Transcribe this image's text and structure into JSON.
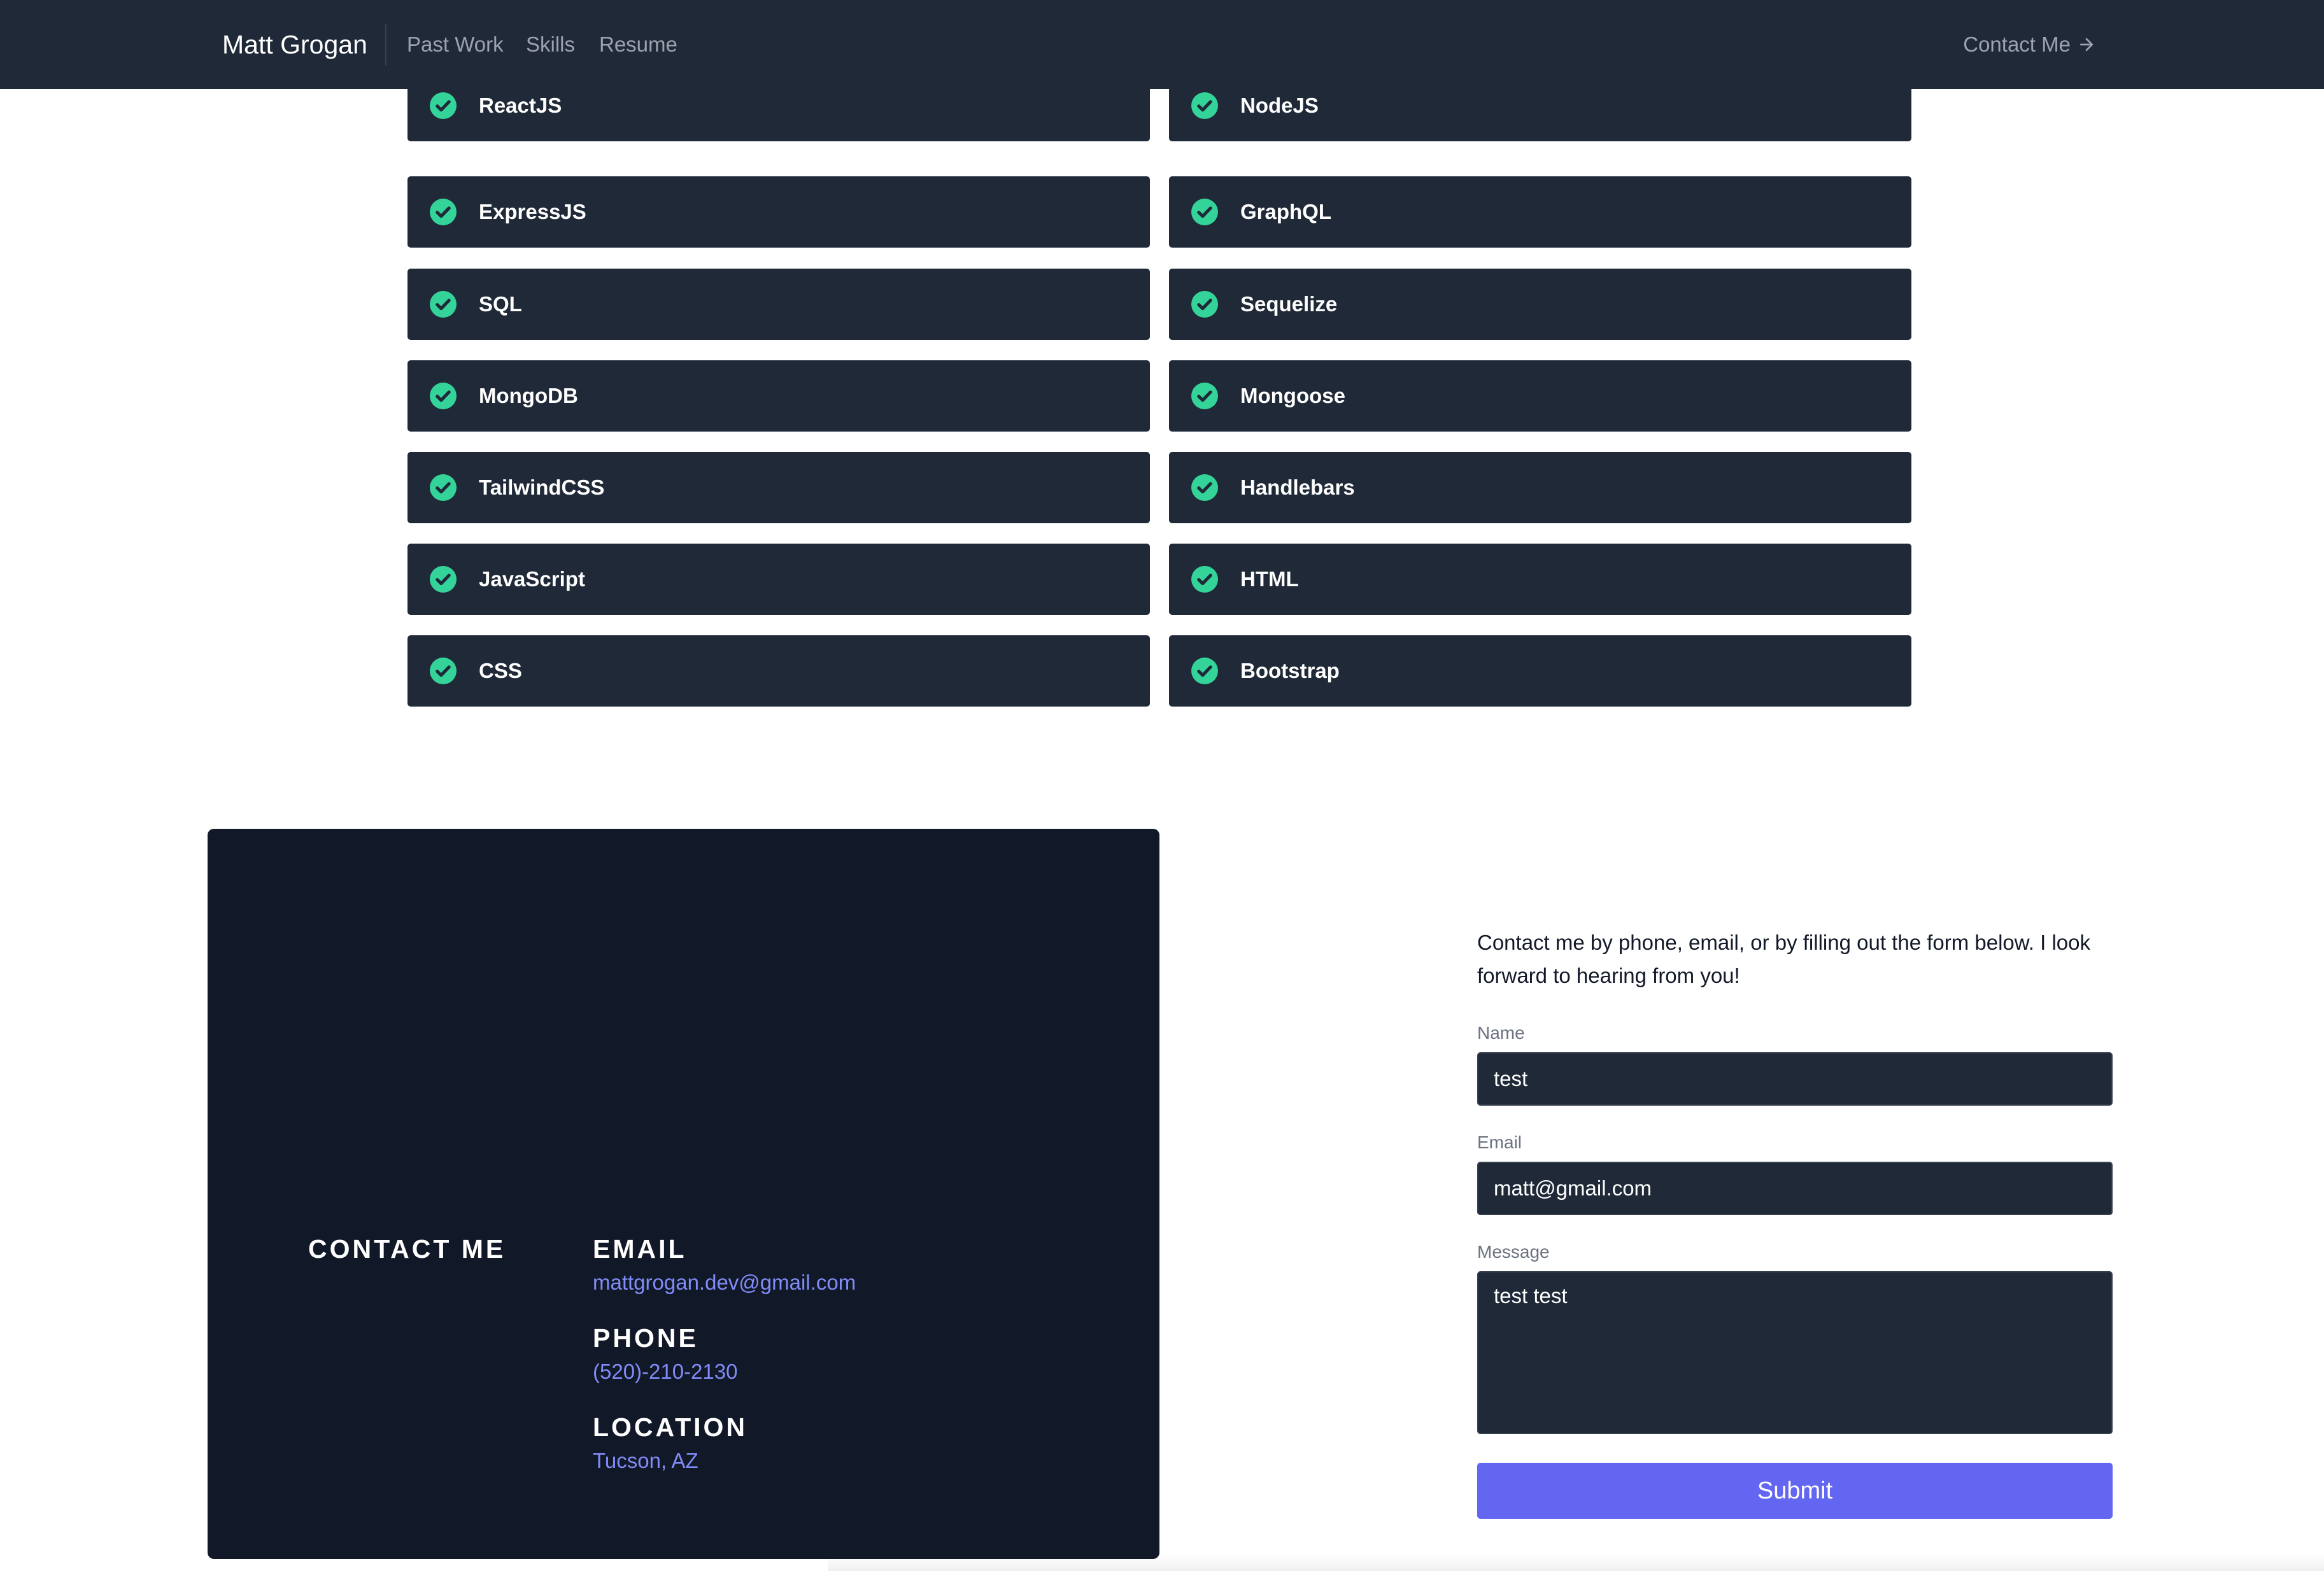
{
  "nav": {
    "brand": "Matt Grogan",
    "links": [
      "Past Work",
      "Skills",
      "Resume"
    ],
    "contact_label": "Contact Me"
  },
  "skills": [
    "ReactJS",
    "NodeJS",
    "ExpressJS",
    "GraphQL",
    "SQL",
    "Sequelize",
    "MongoDB",
    "Mongoose",
    "TailwindCSS",
    "Handlebars",
    "JavaScript",
    "HTML",
    "CSS",
    "Bootstrap"
  ],
  "contact_panel": {
    "title": "CONTACT ME",
    "email_heading": "EMAIL",
    "email": "mattgrogan.dev@gmail.com",
    "phone_heading": "PHONE",
    "phone": "(520)-210-2130",
    "location_heading": "LOCATION",
    "location": "Tucson, AZ"
  },
  "form": {
    "intro": "Contact me by phone, email, or by filling out the form below. I look forward to hearing from you!",
    "name_label": "Name",
    "name_value": "test",
    "email_label": "Email",
    "email_value": "matt@gmail.com",
    "message_label": "Message",
    "message_value": "test test",
    "submit_label": "Submit"
  },
  "colors": {
    "nav_bg": "#1f2937",
    "card_bg": "#1f2937",
    "panel_bg": "#111827",
    "check_green": "#34d399",
    "accent": "#6366f1",
    "link": "#818cf8"
  },
  "icons": {
    "skill": "check-circle-icon",
    "contact": "arrow-right-icon"
  }
}
